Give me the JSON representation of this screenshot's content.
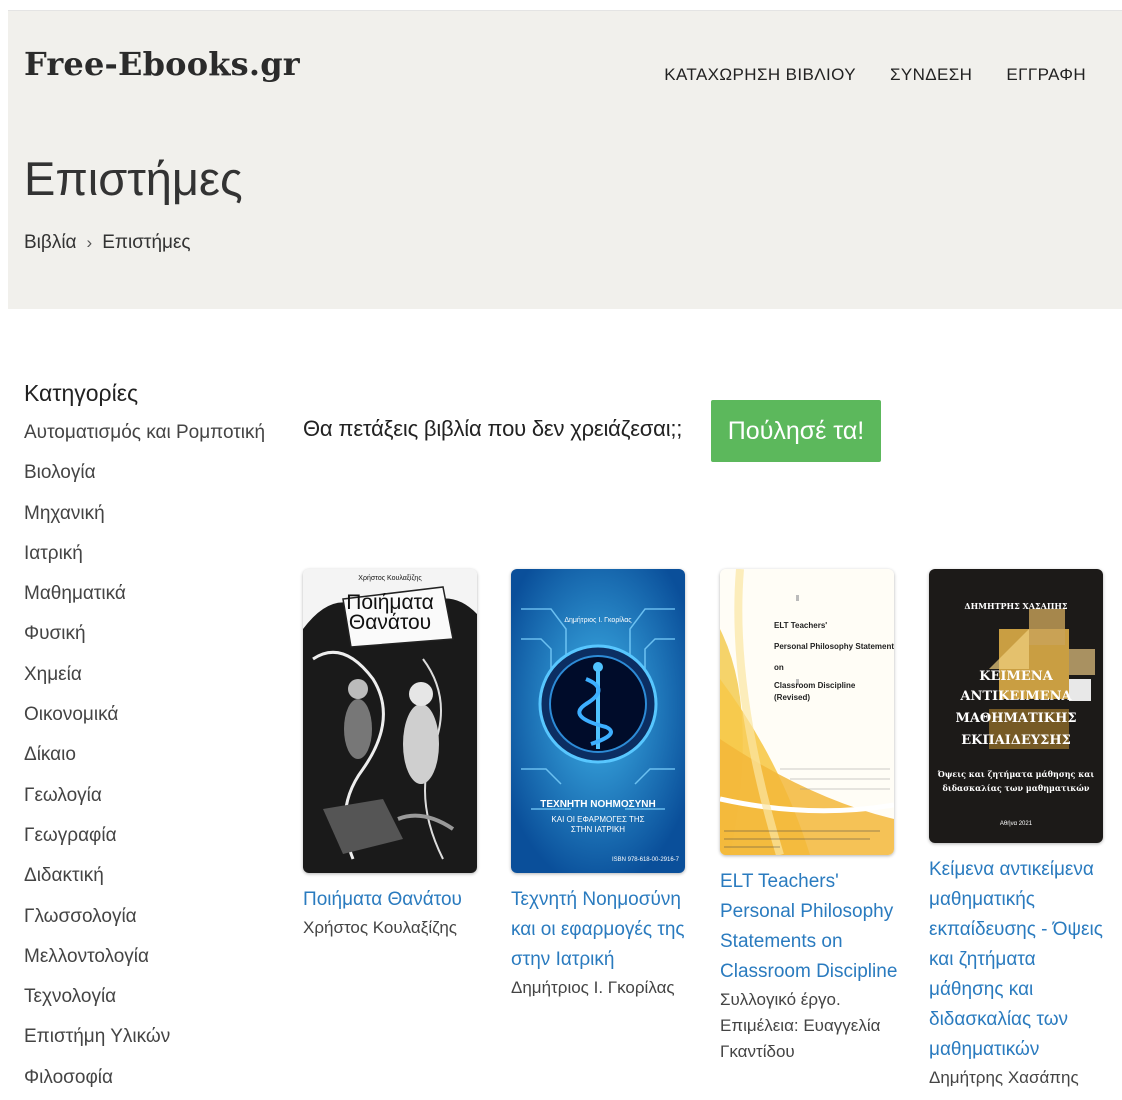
{
  "site": {
    "logo": "Free-Ebooks.gr"
  },
  "nav": {
    "items": [
      {
        "label": "ΚΑΤΑΧΩΡΗΣΗ ΒΙΒΛΙΟΥ"
      },
      {
        "label": "ΣΥΝΔΕΣΗ"
      },
      {
        "label": "ΕΓΓΡΑΦΗ"
      }
    ]
  },
  "page": {
    "title": "Επιστήμες"
  },
  "breadcrumb": {
    "root": "Βιβλία",
    "separator": "›",
    "current": "Επιστήμες"
  },
  "sidebar": {
    "heading": "Κατηγορίες",
    "items": [
      "Αυτοματισμός και Ρομποτική",
      "Βιολογία",
      "Μηχανική",
      "Ιατρική",
      "Μαθηματικά",
      "Φυσική",
      "Χημεία",
      "Οικονομικά",
      "Δίκαιο",
      "Γεωλογία",
      "Γεωγραφία",
      "Διδακτική",
      "Γλωσσολογία",
      "Μελλοντολογία",
      "Τεχνολογία",
      "Επιστήμη Υλικών",
      "Φιλοσοφία"
    ]
  },
  "promo": {
    "text": "Θα πετάξεις βιβλία που δεν χρειάζεσαι;;",
    "button": "Πούλησέ τα!",
    "button_color": "#5cb85c"
  },
  "books": [
    {
      "title": "Ποιήματα Θανάτου",
      "author": "Χρήστος Κουλαξίζης",
      "cover_author": "Χρήστος Κουλαξίζης",
      "cover_title_1": "Ποιήματα",
      "cover_title_2": "Θανάτου"
    },
    {
      "title": "Τεχνητή Νοημοσύνη και οι εφαρμογές της στην Ιατρική",
      "author": "Δημήτριος Ι. Γκορίλας",
      "cover_author": "Δημήτριος Ι. Γκορίλας",
      "cover_title_1": "ΤΕΧΝΗΤΗ ΝΟΗΜΟΣΥΝΗ",
      "cover_title_2": "ΚΑΙ ΟΙ ΕΦΑΡΜΟΓΕΣ ΤΗΣ",
      "cover_title_3": "ΣΤΗΝ ΙΑΤΡΙΚΗ",
      "cover_isbn": "ISBN 978-618-00-2916-7"
    },
    {
      "title": "ELT Teachers' Personal Philosophy Statements on Classroom Discipline",
      "author": "Συλλογικό έργο. Επιμέλεια: Ευαγγελία Γκαντίδου",
      "cover_line_1": "ELT Teachers'",
      "cover_line_2": "Personal Philosophy Statements",
      "cover_line_3": "on",
      "cover_line_4": "Classroom Discipline",
      "cover_line_5": "(Revised)"
    },
    {
      "title": "Κείμενα αντικείμενα μαθηματικής εκπαίδευσης - Όψεις και ζητήματα μάθησης και διδασκαλίας των μαθηματικών",
      "author": "Δημήτρης Χασάπης",
      "cover_author": "ΔΗΜΗΤΡΗΣ ΧΑΣΑΠΗΣ",
      "cover_title_1": "ΚΕΙΜΕΝΑ",
      "cover_title_2": "ΑΝΤΙΚΕΙΜΕΝΑ",
      "cover_title_3": "ΜΑΘΗΜΑΤΙΚΗΣ",
      "cover_title_4": "ΕΚΠΑΙΔΕΥΣΗΣ",
      "cover_sub_1": "Όψεις και ζητήματα μάθησης και",
      "cover_sub_2": "διδασκαλίας των μαθηματικών",
      "cover_place": "Αθήνα 2021"
    }
  ],
  "colors": {
    "header_bg": "#f1f0ec",
    "link": "#2a7bbf"
  }
}
